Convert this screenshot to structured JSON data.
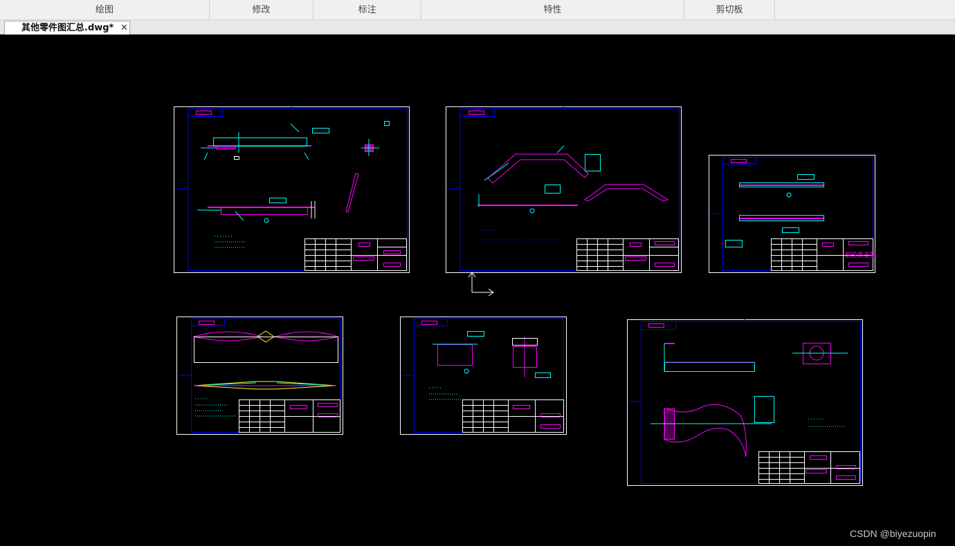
{
  "ribbon": {
    "groups": [
      {
        "label": "绘图"
      },
      {
        "label": "修改"
      },
      {
        "label": "标注"
      },
      {
        "label": "特性"
      },
      {
        "label": "剪切板"
      }
    ]
  },
  "document_tabs": [
    {
      "title": "其他零件图汇总.dwg*",
      "active": true,
      "modified": true
    }
  ],
  "colors": {
    "canvas_bg": "#000000",
    "sheet_border": "#ffffff",
    "frame": "#0000ff",
    "cyan": "#00ffff",
    "magenta": "#ff00ff",
    "yellow": "#ffff00",
    "ucs": "#ffffff"
  },
  "drawing_sheets": [
    {
      "name": "sheet-1",
      "title_block_text": ""
    },
    {
      "name": "sheet-2",
      "title_block_text": ""
    },
    {
      "name": "sheet-3",
      "title_block_text": "前轮蒸支架"
    },
    {
      "name": "sheet-4",
      "title_block_text": ""
    },
    {
      "name": "sheet-5",
      "title_block_text": ""
    },
    {
      "name": "sheet-6",
      "title_block_text": ""
    }
  ],
  "ucs_icon": "ucs-axis-icon",
  "watermark": "CSDN @biyezuopin"
}
